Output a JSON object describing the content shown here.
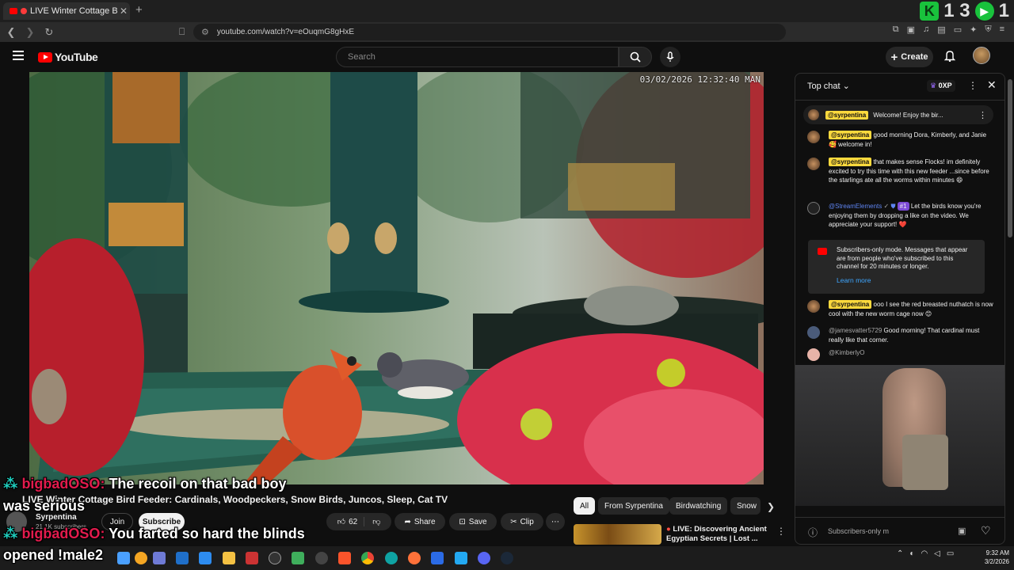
{
  "browser": {
    "tab_title": "LIVE Winter Cottage Bird F",
    "tab_close": "✕",
    "new_tab": "+",
    "url": "youtube.com/watch?v=eOuqmG8gHxE",
    "top_ext_counter": "1 3",
    "top_ext_right": "1"
  },
  "youtube": {
    "logo_text": "YouTube",
    "search_placeholder": "Search",
    "create_label": "Create"
  },
  "video": {
    "timestamp": "03/02/2026 12:32:40 MAN",
    "title": "LIVE Winter Cottage Bird Feeder: Cardinals, Woodpeckers, Snow Birds, Juncos, Sleep, Cat TV",
    "channel_name": "Syrpentina",
    "channel_subs": "21.1K subscribers",
    "join_label": "Join",
    "subscribe_label": "Subscribe",
    "likes": "62",
    "share_label": "Share",
    "save_label": "Save",
    "clip_label": "Clip"
  },
  "overlay": {
    "msg1_name": "bigbadOSO:",
    "msg1_text": " The recoil on that bad boy",
    "msg1_cont": "was serious",
    "msg2_name": "bigbadOSO:",
    "msg2_text": " You farted so hard the blinds",
    "msg2_cont": "opened !male2"
  },
  "chips": {
    "items": [
      "All",
      "From Syrpentina",
      "Birdwatching",
      "Snow"
    ]
  },
  "recommendation": {
    "title_line1": "LIVE: Discovering Ancient",
    "title_line2": "Egyptian Secrets | Lost ..."
  },
  "chat": {
    "mode_label": "Top chat",
    "xp_label": "0XP",
    "pinned_author": "@syrpentina",
    "pinned_text": "Welcome! Enjoy the bir...",
    "messages": [
      {
        "author": "@syrpentina",
        "text": "good morning Dora, Kimberly, and Janie 🥰 welcome in!"
      },
      {
        "author": "@syrpentina",
        "text": "that makes sense Flocks! im definitely excited to try this time with this new feeder ...since before the starlings ate all the worms within minutes 😄"
      },
      {
        "author": "@StreamElements",
        "badge": "#1",
        "text": "Let the birds know you're enjoying them by dropping a like on the video. We appreciate your support! ❤️"
      },
      {
        "author": "@syrpentina",
        "text": "ooo I see the red breasted nuthatch is now cool with the new worm cage now 😊"
      },
      {
        "author": "@jamesvatter5729",
        "text": "Good morning! That cardinal must really like that corner."
      },
      {
        "author": "@KimberlyO",
        "text": ""
      }
    ],
    "system_text": "Subscribers-only mode. Messages that appear are from people who've subscribed to this channel for 20 minutes or longer.",
    "learn_more": "Learn more",
    "input_placeholder": "Subscribers-only m"
  },
  "taskbar": {
    "time": "9:32 AM",
    "date": "3/2/2026"
  }
}
